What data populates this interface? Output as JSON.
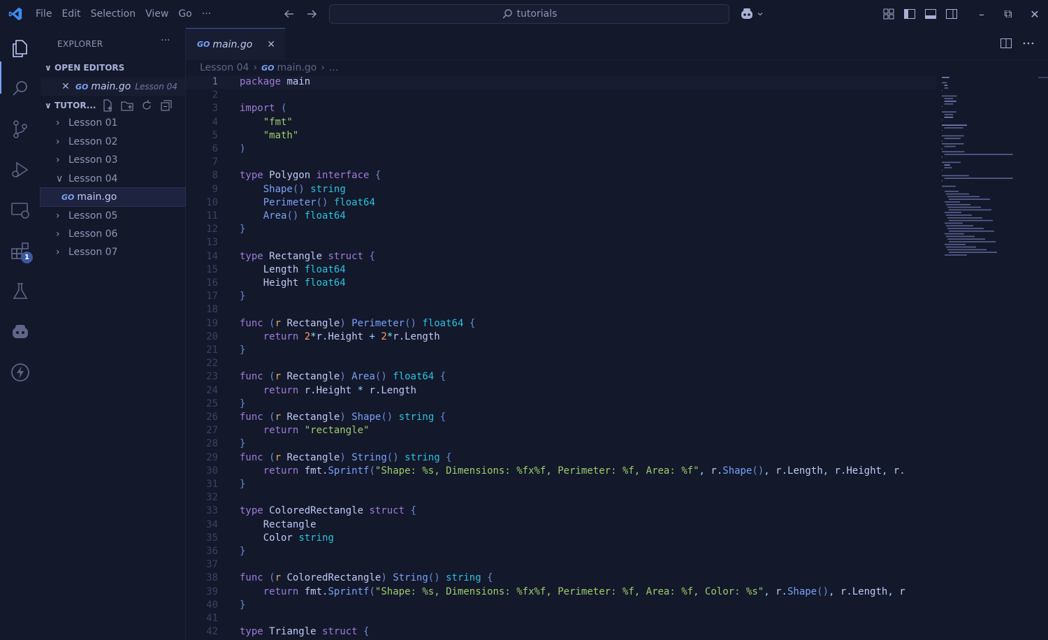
{
  "titlebar": {
    "menu": [
      "File",
      "Edit",
      "Selection",
      "View",
      "Go",
      "···"
    ],
    "search_text": "tutorials"
  },
  "sidebar": {
    "title": "EXPLORER",
    "more": "···",
    "open_editors_label": "OPEN EDITORS",
    "open_editor": {
      "file": "main.go",
      "folder": "Lesson 04",
      "lang": "GO"
    },
    "workspace_label": "TUTOR...",
    "tree": [
      {
        "label": "Lesson 01",
        "type": "folder",
        "expanded": false
      },
      {
        "label": "Lesson 02",
        "type": "folder",
        "expanded": false
      },
      {
        "label": "Lesson 03",
        "type": "folder",
        "expanded": false
      },
      {
        "label": "Lesson 04",
        "type": "folder",
        "expanded": true
      },
      {
        "label": "main.go",
        "type": "file",
        "selected": true
      },
      {
        "label": "Lesson 05",
        "type": "folder",
        "expanded": false
      },
      {
        "label": "Lesson 06",
        "type": "folder",
        "expanded": false
      },
      {
        "label": "Lesson 07",
        "type": "folder",
        "expanded": false
      }
    ]
  },
  "activity_badge": "1",
  "tab": {
    "label": "main.go",
    "lang": "GO"
  },
  "breadcrumb": {
    "folder": "Lesson 04",
    "file": "main.go",
    "more": "..."
  },
  "code_lines": [
    "package main",
    "",
    "import (",
    "    \"fmt\"",
    "    \"math\"",
    ")",
    "",
    "type Polygon interface {",
    "    Shape() string",
    "    Perimeter() float64",
    "    Area() float64",
    "}",
    "",
    "type Rectangle struct {",
    "    Length float64",
    "    Height float64",
    "}",
    "",
    "func (r Rectangle) Perimeter() float64 {",
    "    return 2*r.Height + 2*r.Length",
    "}",
    "",
    "func (r Rectangle) Area() float64 {",
    "    return r.Height * r.Length",
    "}",
    "func (r Rectangle) Shape() string {",
    "    return \"rectangle\"",
    "}",
    "func (r Rectangle) String() string {",
    "    return fmt.Sprintf(\"Shape: %s, Dimensions: %fx%f, Perimeter: %f, Area: %f\", r.Shape(), r.Length, r.Height, r.",
    "}",
    "",
    "type ColoredRectangle struct {",
    "    Rectangle",
    "    Color string",
    "}",
    "",
    "func (r ColoredRectangle) String() string {",
    "    return fmt.Sprintf(\"Shape: %s, Dimensions: %fx%f, Perimeter: %f, Area: %f, Color: %s\", r.Shape(), r.Length, r",
    "}",
    "",
    "type Triangle struct {"
  ],
  "colors": {
    "background": "#13182b",
    "accent": "#7aa2f7",
    "keyword": "#9d7cd8",
    "type": "#2ac3de",
    "string": "#9ece6a",
    "number": "#ff9e64"
  }
}
